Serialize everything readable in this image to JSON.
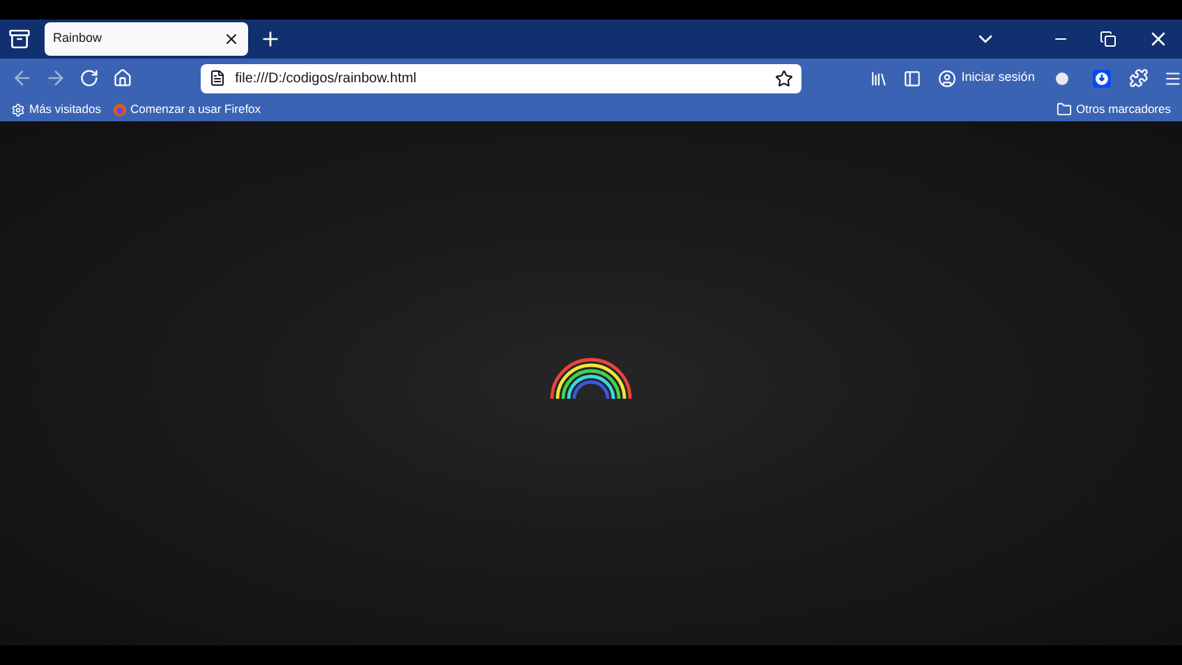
{
  "tabs": [
    {
      "title": "Rainbow",
      "selected": true
    }
  ],
  "toolbar": {
    "url": "file:///D:/codigos/rainbow.html",
    "sign_in": "Iniciar sesión"
  },
  "bookmarks": [
    {
      "label": "Más visitados",
      "kind": "gear"
    },
    {
      "label": "Comenzar a usar Firefox",
      "kind": "browser"
    }
  ],
  "other_bookmarks": "Otros marcadores"
}
